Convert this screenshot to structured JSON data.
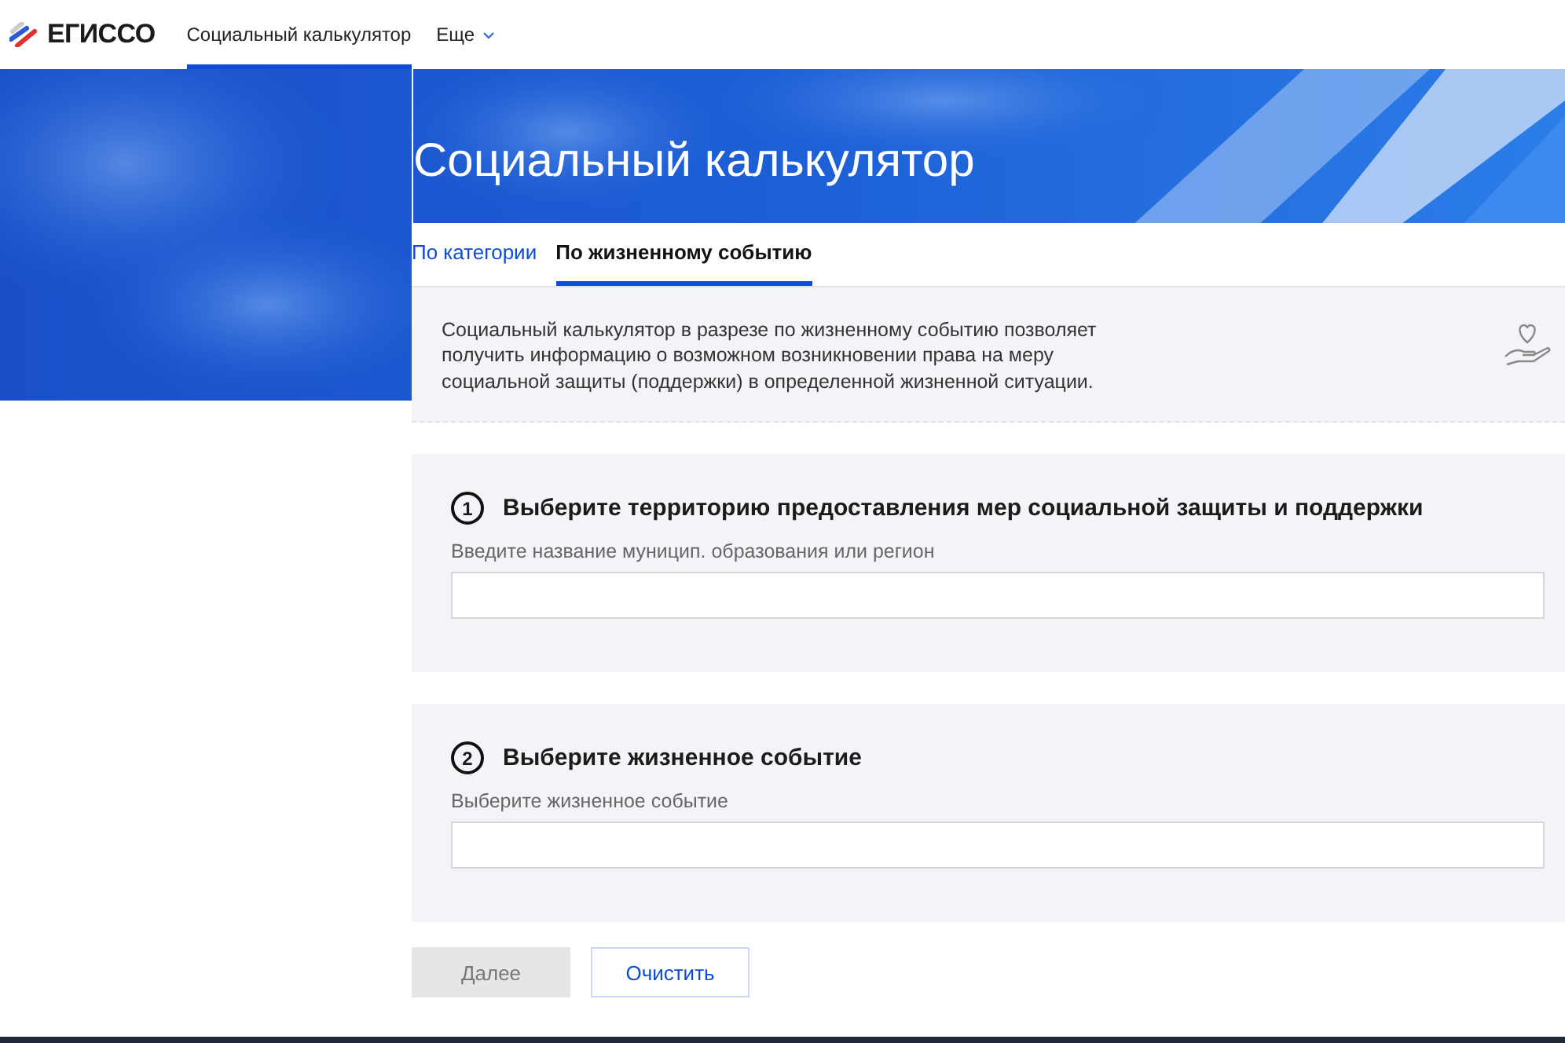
{
  "header": {
    "logo": "ЕГИССО",
    "nav": [
      {
        "label": "Социальный калькулятор",
        "selected": true,
        "dropdown": false
      },
      {
        "label": "Еще",
        "selected": false,
        "dropdown": true
      }
    ]
  },
  "hero": {
    "title": "Социальный калькулятор"
  },
  "tabs": [
    {
      "label": "По категории",
      "selected": false
    },
    {
      "label": "По жизненному событию",
      "selected": true
    }
  ],
  "info": "Социальный калькулятор в разрезе по жизненному событию позволяет получить информацию о возможном возникновении права на меру социальной защиты (поддержки) в определенной жизненной ситуации.",
  "steps": [
    {
      "number": "1",
      "title": "Выберите территорию предоставления мер социальной защиты и поддержки",
      "label": "Введите название муницип. образования или регион"
    },
    {
      "number": "2",
      "title": "Выберите жизненное событие",
      "label": "Выберите жизненное событие"
    }
  ],
  "buttons": [
    {
      "label": "Далее",
      "kind": "primary",
      "disabled": true
    },
    {
      "label": "Очистить",
      "kind": "secondary",
      "disabled": false
    }
  ]
}
